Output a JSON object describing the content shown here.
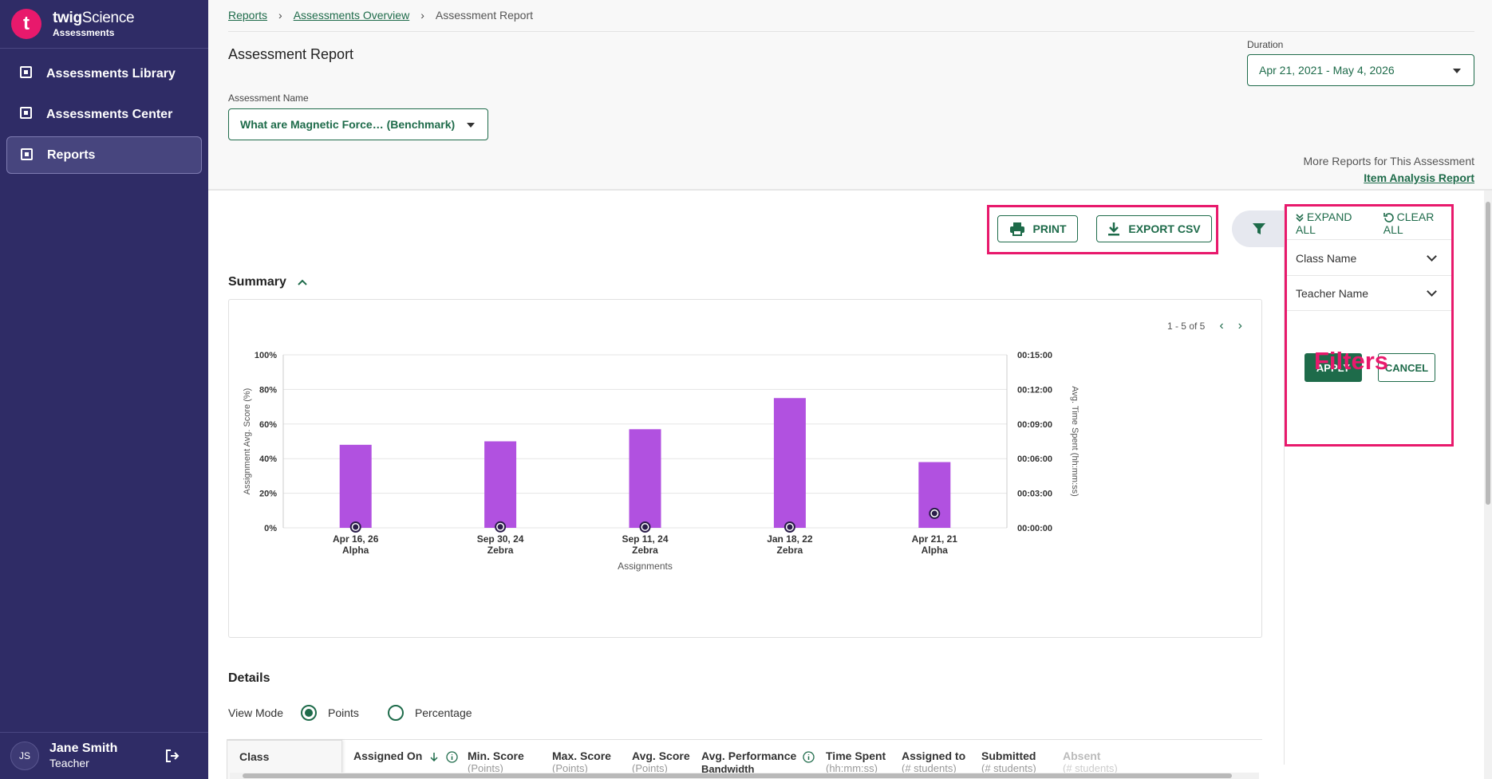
{
  "brand": {
    "logo_letter": "t",
    "name_prefix": "twig",
    "name_suffix": "Science",
    "subtitle": "Assessments"
  },
  "sidebar": {
    "items": [
      {
        "label": "Assessments Library",
        "icon": "library-icon"
      },
      {
        "label": "Assessments Center",
        "icon": "calendar-icon"
      },
      {
        "label": "Reports",
        "icon": "chart-icon",
        "active": true
      }
    ],
    "user": {
      "initials": "JS",
      "name": "Jane Smith",
      "role": "Teacher"
    }
  },
  "breadcrumb": {
    "reports": "Reports",
    "overview": "Assessments Overview",
    "current": "Assessment Report"
  },
  "header": {
    "title": "Assessment Report",
    "assessment_name_label": "Assessment Name",
    "assessment_name_value": "What are Magnetic Force… (Benchmark)",
    "duration_label": "Duration",
    "duration_value": "Apr 21, 2021 - May 4, 2026",
    "more_reports_label": "More Reports for This Assessment",
    "item_analysis_link": "Item Analysis Report"
  },
  "toolbar": {
    "print_label": "PRINT",
    "export_label": "EXPORT CSV"
  },
  "summary": {
    "title": "Summary",
    "pager_text": "1 - 5 of 5"
  },
  "chart_data": {
    "type": "bar",
    "categories": [
      "Apr 16, 26",
      "Sep 30, 24",
      "Sep 11, 24",
      "Jan 18, 22",
      "Apr 21, 21"
    ],
    "category_sublabels": [
      "Alpha",
      "Zebra",
      "Zebra",
      "Zebra",
      "Alpha"
    ],
    "series": [
      {
        "name": "Assignment Avg. Score (%)",
        "type": "bar",
        "axis": "left",
        "color": "#b151e0",
        "values": [
          48,
          50,
          57,
          75,
          38
        ]
      },
      {
        "name": "Avg. Time Spent (hh:mm:ss)",
        "type": "point",
        "axis": "right",
        "color": "#2b1d4a",
        "values": [
          "00:00:00",
          "00:00:05",
          "00:00:00",
          "00:00:00",
          "00:01:15"
        ],
        "values_seconds": [
          0,
          5,
          0,
          0,
          75
        ]
      }
    ],
    "xlabel": "Assignments",
    "ylabel": "Assignment Avg. Score (%)",
    "y2label": "Avg. Time Spent (hh:mm:ss)",
    "ylim": [
      0,
      100
    ],
    "y2lim_seconds": [
      0,
      900
    ],
    "yticks": [
      "0%",
      "20%",
      "40%",
      "60%",
      "80%",
      "100%"
    ],
    "y2ticks": [
      "00:00:00",
      "00:03:00",
      "00:06:00",
      "00:09:00",
      "00:12:00",
      "00:15:00"
    ],
    "grid": true
  },
  "details": {
    "title": "Details",
    "view_mode_label": "View Mode",
    "points_label": "Points",
    "percentage_label": "Percentage",
    "columns": [
      {
        "label": "Class",
        "sub": ""
      },
      {
        "label": "Assigned On",
        "sub": ""
      },
      {
        "label": "Min. Score",
        "sub": "(Points)"
      },
      {
        "label": "Max. Score",
        "sub": "(Points)"
      },
      {
        "label": "Avg. Score",
        "sub": "(Points)"
      },
      {
        "label": "Avg. Performance",
        "sub": "Bandwidth"
      },
      {
        "label": "Time Spent",
        "sub": "(hh:mm:ss)"
      },
      {
        "label": "Assigned to",
        "sub": "(# students)"
      },
      {
        "label": "Submitted",
        "sub": "(# students)"
      },
      {
        "label": "Absent",
        "sub": "(# students)"
      }
    ]
  },
  "filters": {
    "expand_all": "EXPAND ALL",
    "clear_all": "CLEAR ALL",
    "class_name": "Class Name",
    "teacher_name": "Teacher Name",
    "apply": "APPLY",
    "cancel": "CANCEL",
    "annotation": "Filters"
  },
  "colors": {
    "accent": "#1e6b4a",
    "sidebar": "#2f2c66",
    "highlight": "#e8196c",
    "bar": "#b151e0"
  }
}
